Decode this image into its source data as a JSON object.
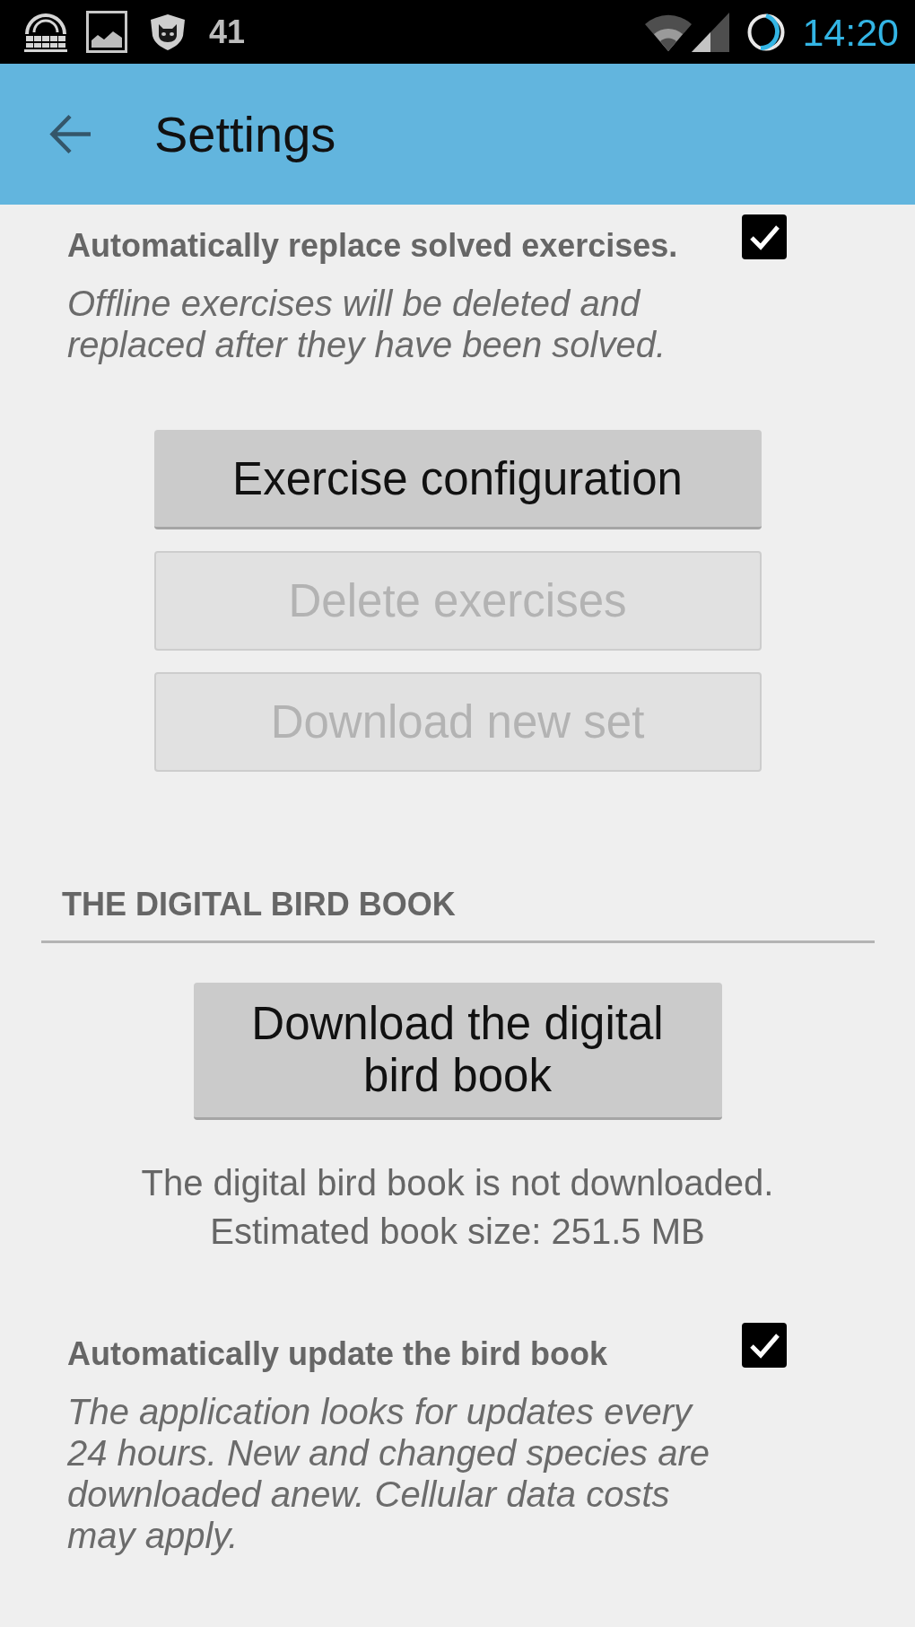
{
  "status_bar": {
    "notification_count": "41",
    "time": "14:20"
  },
  "app_bar": {
    "title": "Settings"
  },
  "exercises": {
    "preference": {
      "title": "Automatically replace solved exercises.",
      "summary": "Offline exercises will be deleted and replaced after they have been solved.",
      "checked": true
    },
    "buttons": [
      {
        "label": "Exercise configuration",
        "disabled": false
      },
      {
        "label": "Delete exercises",
        "disabled": true
      },
      {
        "label": "Download new set",
        "disabled": true
      }
    ]
  },
  "bird_book": {
    "header": "THE DIGITAL BIRD BOOK",
    "download_button": {
      "label": "Download the digital bird book",
      "disabled": false
    },
    "status_text": "The digital bird book is not downloaded.\nEstimated book size: 251.5 MB",
    "preference": {
      "title": "Automatically update the bird book",
      "summary": "The application looks for updates every 24 hours. New and changed species are downloaded anew. Cellular data costs may apply.",
      "checked": true
    }
  }
}
